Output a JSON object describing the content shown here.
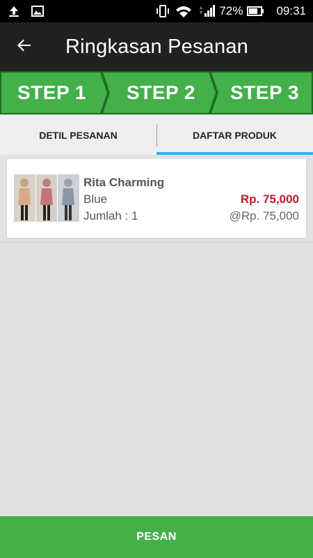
{
  "status_bar": {
    "battery_percent": "72%",
    "time": "09:31",
    "icons": [
      "upload-icon",
      "image-icon",
      "vibrate-icon",
      "wifi-icon",
      "signal-icon",
      "battery-icon"
    ]
  },
  "app_bar": {
    "back_icon": "arrow-left-icon",
    "title": "Ringkasan Pesanan"
  },
  "steps": [
    {
      "label": "STEP 1"
    },
    {
      "label": "STEP 2"
    },
    {
      "label": "STEP 3"
    }
  ],
  "tabs": [
    {
      "label": "DETIL PESANAN",
      "active": false
    },
    {
      "label": "DAFTAR PRODUK",
      "active": true
    }
  ],
  "product": {
    "name": "Rita Charming",
    "variant": "Blue",
    "quantity_label": "Jumlah : 1",
    "total_price": "Rp. 75,000",
    "unit_price": "@Rp. 75,000"
  },
  "footer": {
    "order_button": "PESAN"
  },
  "colors": {
    "step_green": "#43b04a",
    "accent_blue": "#29b6f6",
    "price_red": "#c2172b",
    "app_bar": "#212121"
  }
}
